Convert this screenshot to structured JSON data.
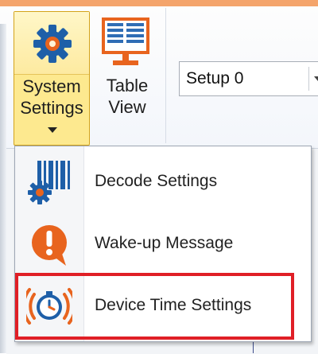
{
  "ribbon": {
    "system_settings": {
      "label_line1": "System",
      "label_line2": "Settings",
      "icon": "gear-icon"
    },
    "table_view": {
      "label_line1": "Table",
      "label_line2": "View",
      "icon": "monitor-table-icon"
    },
    "setup_combo": {
      "value": "Setup 0"
    }
  },
  "menu": {
    "items": [
      {
        "label": "Decode Settings",
        "icon": "barcode-gear-icon"
      },
      {
        "label": "Wake-up Message",
        "icon": "exclamation-bubble-icon"
      },
      {
        "label": "Device Time Settings",
        "icon": "clock-signal-icon",
        "highlighted": true
      }
    ]
  },
  "colors": {
    "accent_orange": "#e8641e",
    "selection_yellow": "#fde98f",
    "highlight_red": "#e01f26",
    "icon_blue": "#1e5fa8"
  }
}
